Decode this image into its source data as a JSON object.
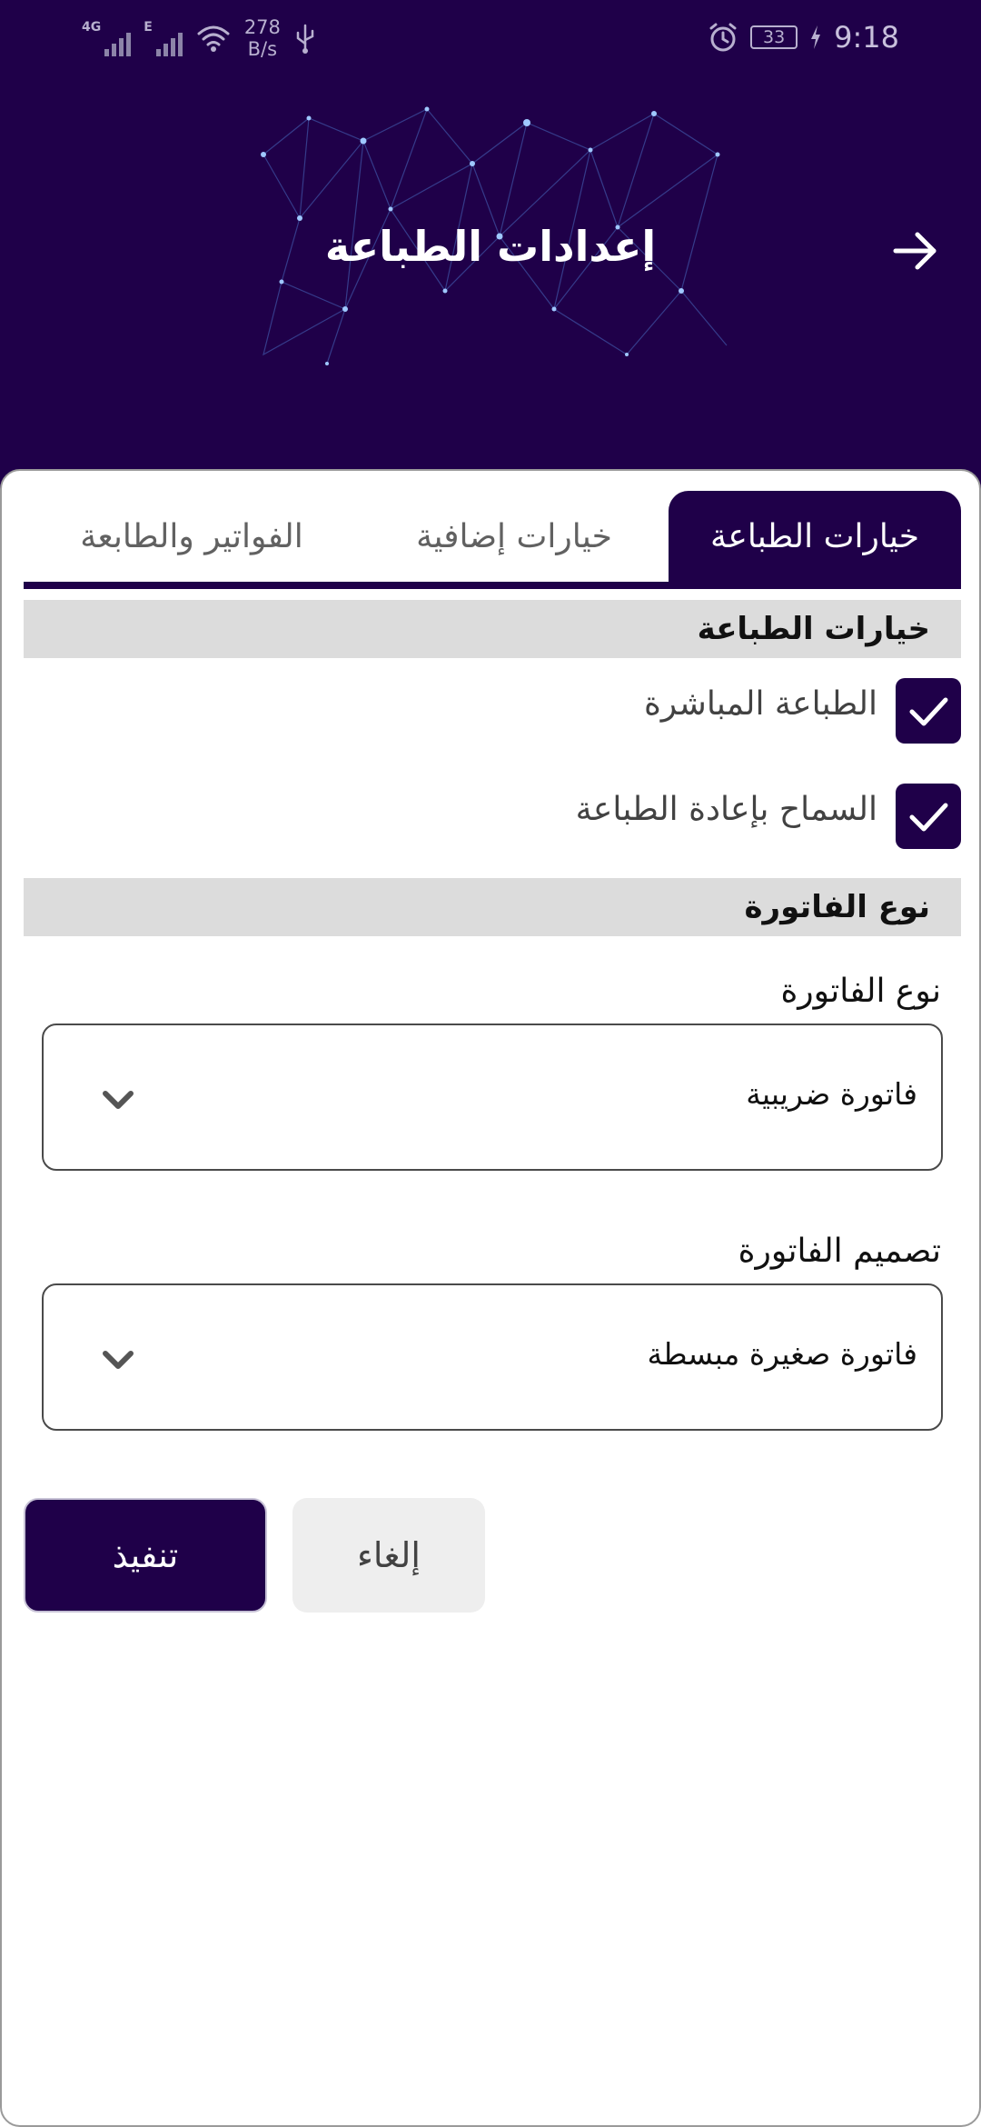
{
  "status_bar": {
    "left_tag_1": "4G",
    "left_tag_2": "E",
    "speed_value": "278",
    "speed_unit": "B/s",
    "battery": "33",
    "time": "9:18"
  },
  "header": {
    "title": "إعدادات الطباعة",
    "back_icon": "arrow-right-icon"
  },
  "tabs": [
    {
      "label": "خيارات الطباعة",
      "active": true
    },
    {
      "label": "خيارات إضافية",
      "active": false
    },
    {
      "label": "الفواتير والطابعة",
      "active": false
    }
  ],
  "print_options": {
    "title": "خيارات الطباعة",
    "items": [
      {
        "label": "الطباعة المباشرة",
        "checked": true
      },
      {
        "label": "السماح بإعادة الطباعة",
        "checked": true
      }
    ]
  },
  "invoice_type": {
    "title": "نوع الفاتورة",
    "type_label": "نوع الفاتورة",
    "type_value": "فاتورة ضريبية",
    "design_label": "تصميم الفاتورة",
    "design_value": "فاتورة صغيرة مبسطة"
  },
  "actions": {
    "execute_label": "تنفيذ",
    "cancel_label": "إلغاء"
  },
  "colors": {
    "primary": "#1f0049",
    "section_bg": "#dcdcdc",
    "cancel_bg": "#eeeeee"
  }
}
